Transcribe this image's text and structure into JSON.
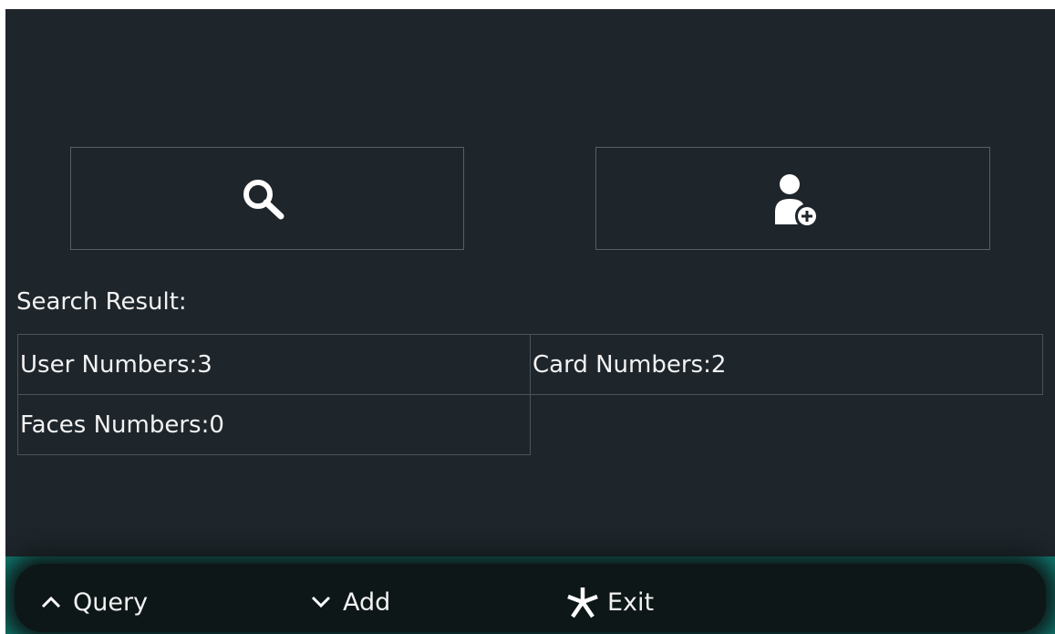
{
  "actions": {
    "query_icon": "search-icon",
    "add_icon": "add-user-icon"
  },
  "search": {
    "result_label": "Search Result:",
    "user_numbers": "User Numbers:3",
    "card_numbers": "Card Numbers:2",
    "faces_numbers": "Faces Numbers:0"
  },
  "softkeys": {
    "query_label": "Query",
    "query_icon": "chevron-up-icon",
    "add_label": "Add",
    "add_icon": "chevron-down-icon",
    "exit_label": "Exit",
    "exit_icon": "asterisk-icon"
  },
  "colors": {
    "background": "#1e252b",
    "bottom_bar_glow": "#0f7b70",
    "text": "#f2f2f2"
  }
}
